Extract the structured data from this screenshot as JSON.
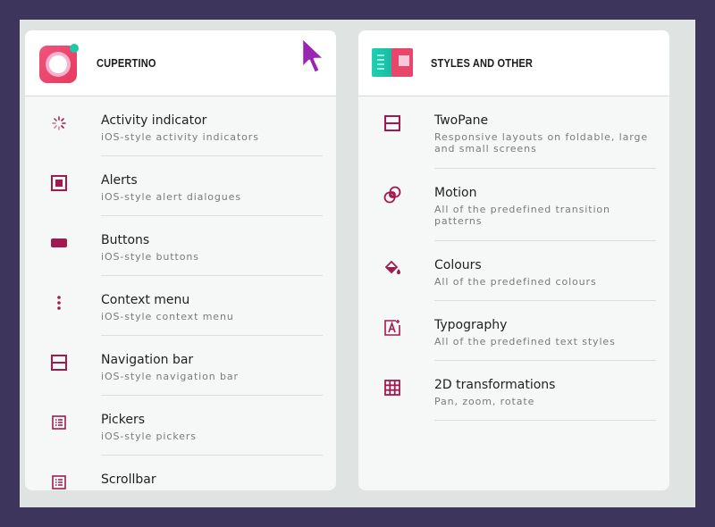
{
  "colors": {
    "accent": "#a3194f",
    "background": "#3d355c"
  },
  "left_panel": {
    "title": "CUPERTINO",
    "items": [
      {
        "title": "Activity indicator",
        "subtitle": "iOS-style activity indicators",
        "icon": "activity-indicator-icon"
      },
      {
        "title": "Alerts",
        "subtitle": "iOS-style alert dialogues",
        "icon": "alert-icon"
      },
      {
        "title": "Buttons",
        "subtitle": "iOS-style buttons",
        "icon": "button-icon"
      },
      {
        "title": "Context menu",
        "subtitle": "iOS-style context menu",
        "icon": "more-vert-icon"
      },
      {
        "title": "Navigation bar",
        "subtitle": "iOS-style navigation bar",
        "icon": "navigation-bar-icon"
      },
      {
        "title": "Pickers",
        "subtitle": "iOS-style pickers",
        "icon": "list-icon"
      },
      {
        "title": "Scrollbar",
        "icon": "list-icon"
      }
    ]
  },
  "right_panel": {
    "title": "STYLES AND OTHER",
    "items": [
      {
        "title": "TwoPane",
        "subtitle": "Responsive layouts on foldable, large and small screens",
        "icon": "two-pane-icon"
      },
      {
        "title": "Motion",
        "subtitle": "All of the predefined transition patterns",
        "icon": "motion-icon"
      },
      {
        "title": "Colours",
        "subtitle": "All of the predefined colours",
        "icon": "paint-bucket-icon"
      },
      {
        "title": "Typography",
        "subtitle": "All of the predefined text styles",
        "icon": "typography-icon"
      },
      {
        "title": "2D transformations",
        "subtitle": "Pan, zoom, rotate",
        "icon": "grid-icon"
      }
    ]
  }
}
